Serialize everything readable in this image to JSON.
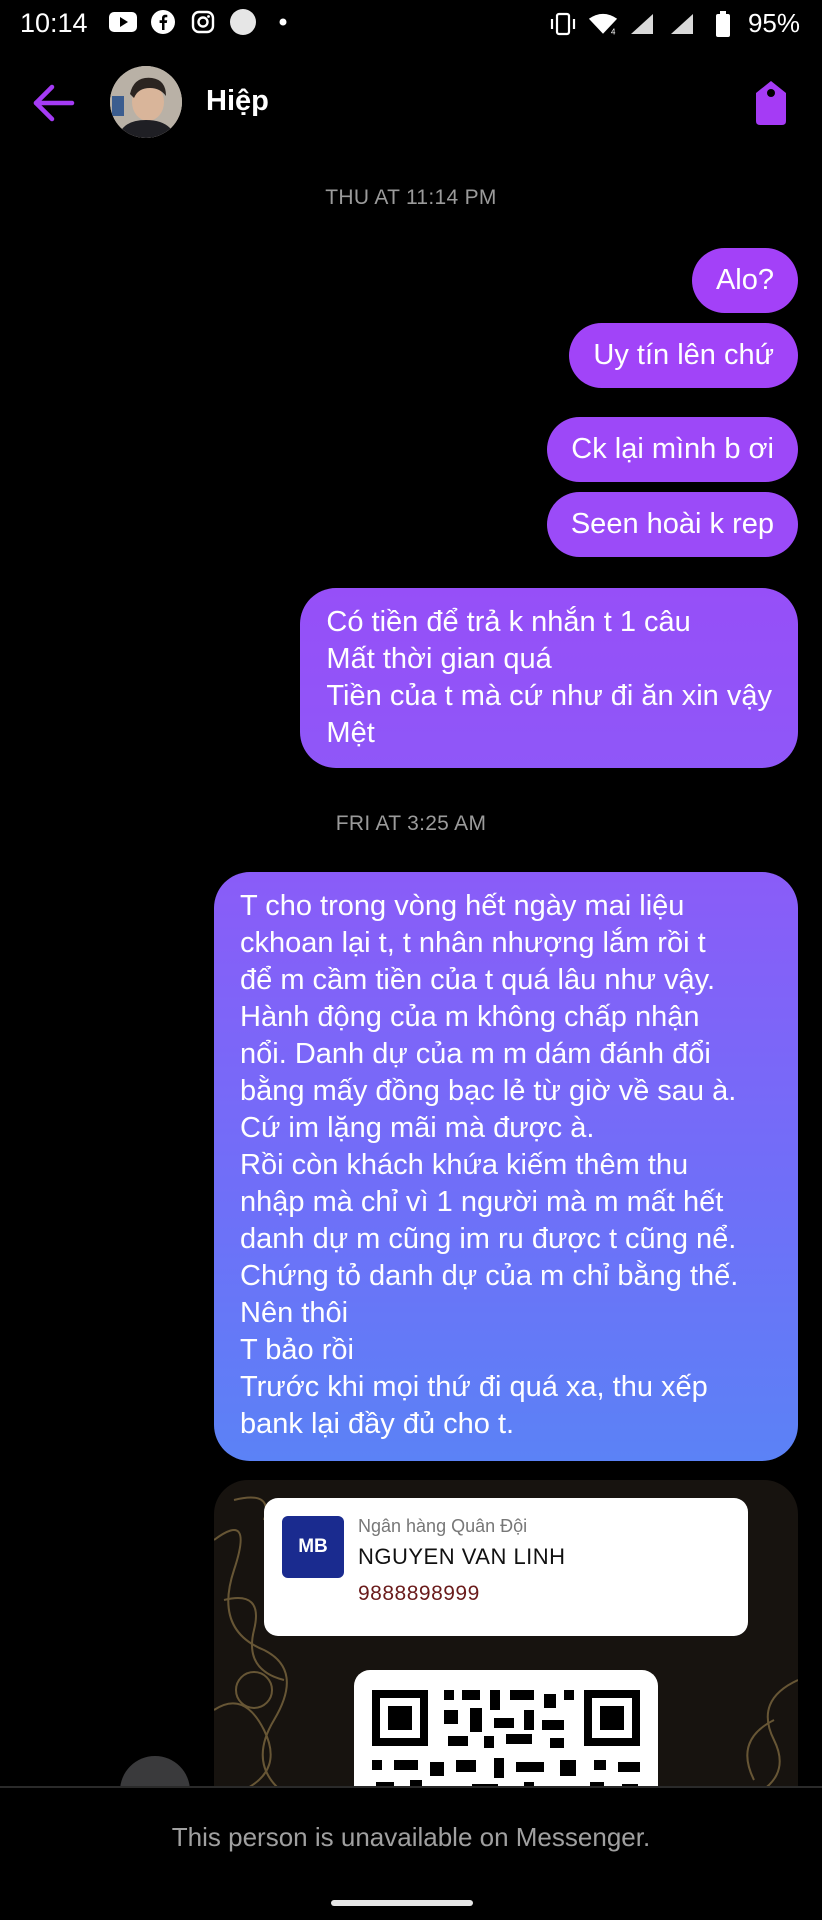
{
  "status_bar": {
    "time": "10:14",
    "battery": "95%",
    "icons": [
      "youtube-icon",
      "facebook-icon",
      "instagram-icon",
      "circle-app-icon",
      "dot-icon",
      "vibrate-icon",
      "wifi-icon",
      "signal-icon",
      "signal-icon-2",
      "battery-icon"
    ]
  },
  "header": {
    "contact_name": "Hiệp",
    "accent_color": "#a53bf5"
  },
  "conversation": {
    "timestamp_1": "THU AT 11:14 PM",
    "timestamp_2": "FRI AT 3:25 AM",
    "messages": [
      {
        "lines": [
          "Alo?"
        ]
      },
      {
        "lines": [
          "Uy tín lên chứ"
        ]
      },
      {
        "lines": [
          "Ck lại mình b ơi"
        ]
      },
      {
        "lines": [
          "Seen hoài k rep"
        ]
      },
      {
        "lines": [
          "Có tiền để trả k nhắn t 1 câu",
          "Mất thời gian quá",
          "Tiền của t mà cứ như đi ăn xin vậy",
          "Mệt"
        ]
      },
      {
        "lines": [
          "T cho trong vòng hết ngày mai liệu",
          "ckhoan lại t, t nhân nhượng lắm rồi t",
          "để m cầm tiền của t quá lâu như vậy.",
          "Hành động của m không chấp nhận",
          "nổi. Danh dự của m m dám đánh đổi",
          "bằng mấy đồng bạc lẻ từ giờ về sau à.",
          "Cứ im lặng mãi mà được à.",
          "Rồi còn khách khứa kiếm thêm thu",
          "nhập mà chỉ vì 1 người mà m mất hết",
          "danh dự m cũng im ru được t cũng nể.",
          "Chứng tỏ danh dự của m chỉ bằng thế.",
          "Nên thôi",
          "T bảo rồi",
          "Trước khi mọi thứ đi quá xa, thu xếp",
          "bank lại đầy đủ cho t."
        ]
      }
    ],
    "bank_card": {
      "logo": "MB",
      "bank_name": "Ngân hàng Quân Đội",
      "account_name": "NGUYEN VAN LINH",
      "account_number": "9888898999"
    }
  },
  "footer": {
    "unavailable": "This person is unavailable on Messenger."
  }
}
